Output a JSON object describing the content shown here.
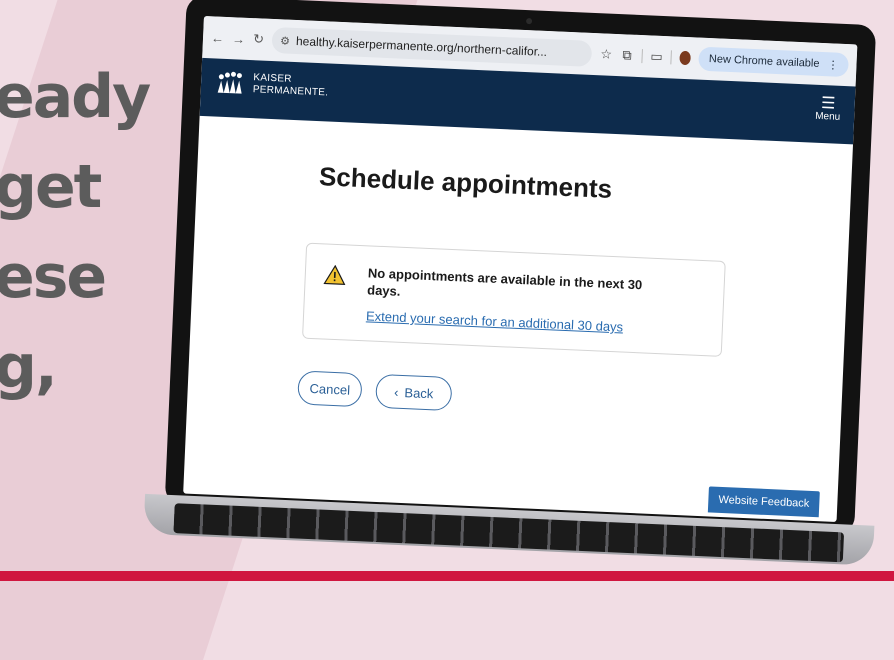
{
  "background": {
    "text_lines": [
      "eady",
      "get",
      "ese",
      "g,"
    ]
  },
  "browser": {
    "url": "healthy.kaiserpermanente.org/northern-califor...",
    "update_label": "New Chrome available"
  },
  "header": {
    "logo_line1": "KAISER",
    "logo_line2": "PERMANENTE.",
    "menu_label": "Menu"
  },
  "page": {
    "title": "Schedule appointments",
    "alert_message": "No appointments are available in the next 30 days.",
    "alert_link": "Extend your search for an additional 30 days",
    "cancel_label": "Cancel",
    "back_label": "Back",
    "feedback_label": "Website Feedback"
  },
  "colors": {
    "header_bg": "#0d2b4c",
    "link": "#2a6cb0",
    "warning": "#f2c230",
    "accent_bar": "#d0163f"
  }
}
